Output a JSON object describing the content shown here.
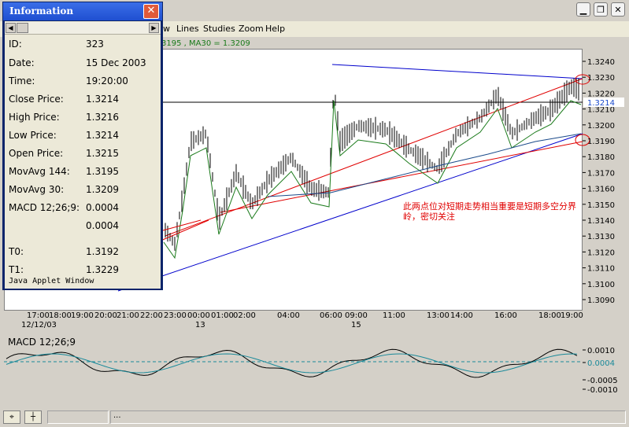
{
  "window": {
    "menu": [
      "w",
      "Lines",
      "Studies",
      "Zoom",
      "Help"
    ],
    "ma_legend": "3195  , MA30 = 1.3209"
  },
  "info_popup": {
    "title": "Information",
    "close_glyph": "✕",
    "rows": [
      {
        "label": "ID:",
        "value": "323"
      },
      {
        "label": "Date:",
        "value": "15 Dec 2003"
      },
      {
        "label": "Time:",
        "value": "19:20:00"
      },
      {
        "label": "Close Price:",
        "value": "1.3214"
      },
      {
        "label": "High Price:",
        "value": "1.3216"
      },
      {
        "label": "Low Price:",
        "value": "1.3214"
      },
      {
        "label": "Open Price:",
        "value": "1.3215"
      },
      {
        "label": "MovAvg 144:",
        "value": "1.3195"
      },
      {
        "label": "MovAvg 30:",
        "value": "1.3209"
      },
      {
        "label": "MACD 12;26;9:",
        "value": "0.0004"
      },
      {
        "label": "",
        "value": "0.0004"
      },
      {
        "label": "T0:",
        "value": "1.3192"
      },
      {
        "label": "T1:",
        "value": "1.3229"
      }
    ],
    "footer": "Java Applet Window"
  },
  "price_axis": {
    "ticks": [
      "1.3240",
      "1.3230",
      "1.3220",
      "1.3210",
      "1.3200",
      "1.3190",
      "1.3180",
      "1.3170",
      "1.3160",
      "1.3150",
      "1.3140",
      "1.3130",
      "1.3120",
      "1.3110",
      "1.3100",
      "1.3090"
    ],
    "current_price": "1.3214"
  },
  "time_axis": {
    "labels": [
      "17:00",
      "18:00",
      "19:00",
      "20:00",
      "21:00",
      "22:00",
      "23:00",
      "00:00",
      "01:00",
      "02:00",
      "04:00",
      "06:00",
      "09:00",
      "11:00",
      "13:00",
      "14:00",
      "16:00",
      "18:00",
      "19:00"
    ],
    "date_labels": [
      "12/12/03",
      "13",
      "15"
    ]
  },
  "annotation": "此两点位对短期走势相当重要是短期多空分界岭，密切关注",
  "macd": {
    "title": "MACD 12;26;9",
    "ticks": [
      "0.0010",
      "0.0004",
      "-0.0005",
      "-0.0010"
    ],
    "current_value": "0.0004"
  },
  "colors": {
    "price_line": "#000000",
    "ma30": "#1a7a1a",
    "ma144": "#1a4a8a",
    "trendline_blue": "#0000cc",
    "trendline_red": "#e00000",
    "macd_signal": "#1a8a9a",
    "current": "#1a4acc"
  },
  "statusbar": {
    "icon1": "crosshair-icon",
    "icon2": "hline-icon",
    "field_text": "..."
  }
}
